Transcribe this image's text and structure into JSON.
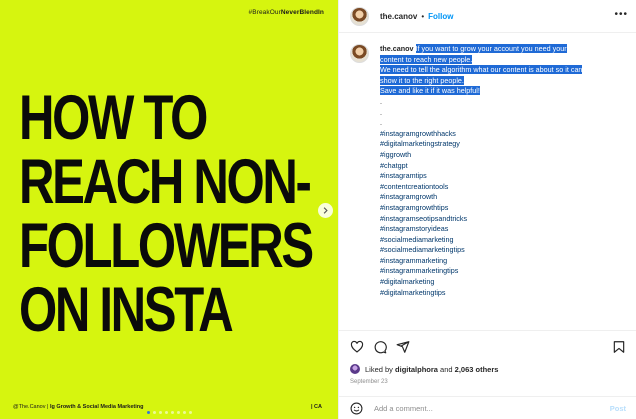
{
  "media": {
    "tag_prefix": "#BreakOur",
    "tag_bold": "NeverBlendIn",
    "headline": [
      "HOW TO",
      "REACH NON-",
      "FOLLOWERS",
      "ON INSTA"
    ],
    "footer_left_prefix": "@The.Canov |",
    "footer_left_bold": "Ig Growth & Social Media Marketing",
    "footer_right": "| CA",
    "next_icon": "chevron-right-icon",
    "carousel_total": 8,
    "carousel_active": 0,
    "background_color": "#d6f50f"
  },
  "header": {
    "username": "the.canov",
    "separator": "•",
    "follow_label": "Follow",
    "more_label": "•••"
  },
  "caption": {
    "author": "the.canov",
    "highlighted_lines": [
      "If you want to grow your account you need your",
      "content to reach new people.",
      " ",
      "We need to tell the algorithm what our content is about so it can",
      "show it to the right people.",
      " ",
      "Save and like it if it was helpful!"
    ],
    "dots": [
      ".",
      ".",
      "."
    ],
    "hashtags": [
      "#instagramgrowthhacks",
      "#digitalmarketingstrategy",
      "#iggrowth",
      "#chatgpt",
      "#instagramtips",
      "#contentcreationtools",
      "#instagramgrowth",
      "#instagramgrowthtips",
      "#instagramseotipsandtricks",
      "#instagramstoryideas",
      "#socialmediamarketing",
      "#socialmediamarketingtips",
      "#instagrammarketing",
      "#instagrammarketingtips",
      "#digitalmarketing",
      "#digitalmarketingtips"
    ],
    "highlight_color": "#1f6ad6",
    "hashtag_color": "#00376b"
  },
  "actions": {
    "icons": [
      "heart-icon",
      "comment-icon",
      "share-icon",
      "bookmark-icon"
    ],
    "liked_by_prefix": "Liked by",
    "liked_by_user": "digitalphora",
    "liked_by_and": "and",
    "liked_by_count": "2,063 others",
    "date": "September 23"
  },
  "comment": {
    "placeholder": "Add a comment...",
    "post_label": "Post",
    "post_color": "#b9dffc"
  },
  "colors": {
    "accent_link": "#0095f6"
  }
}
